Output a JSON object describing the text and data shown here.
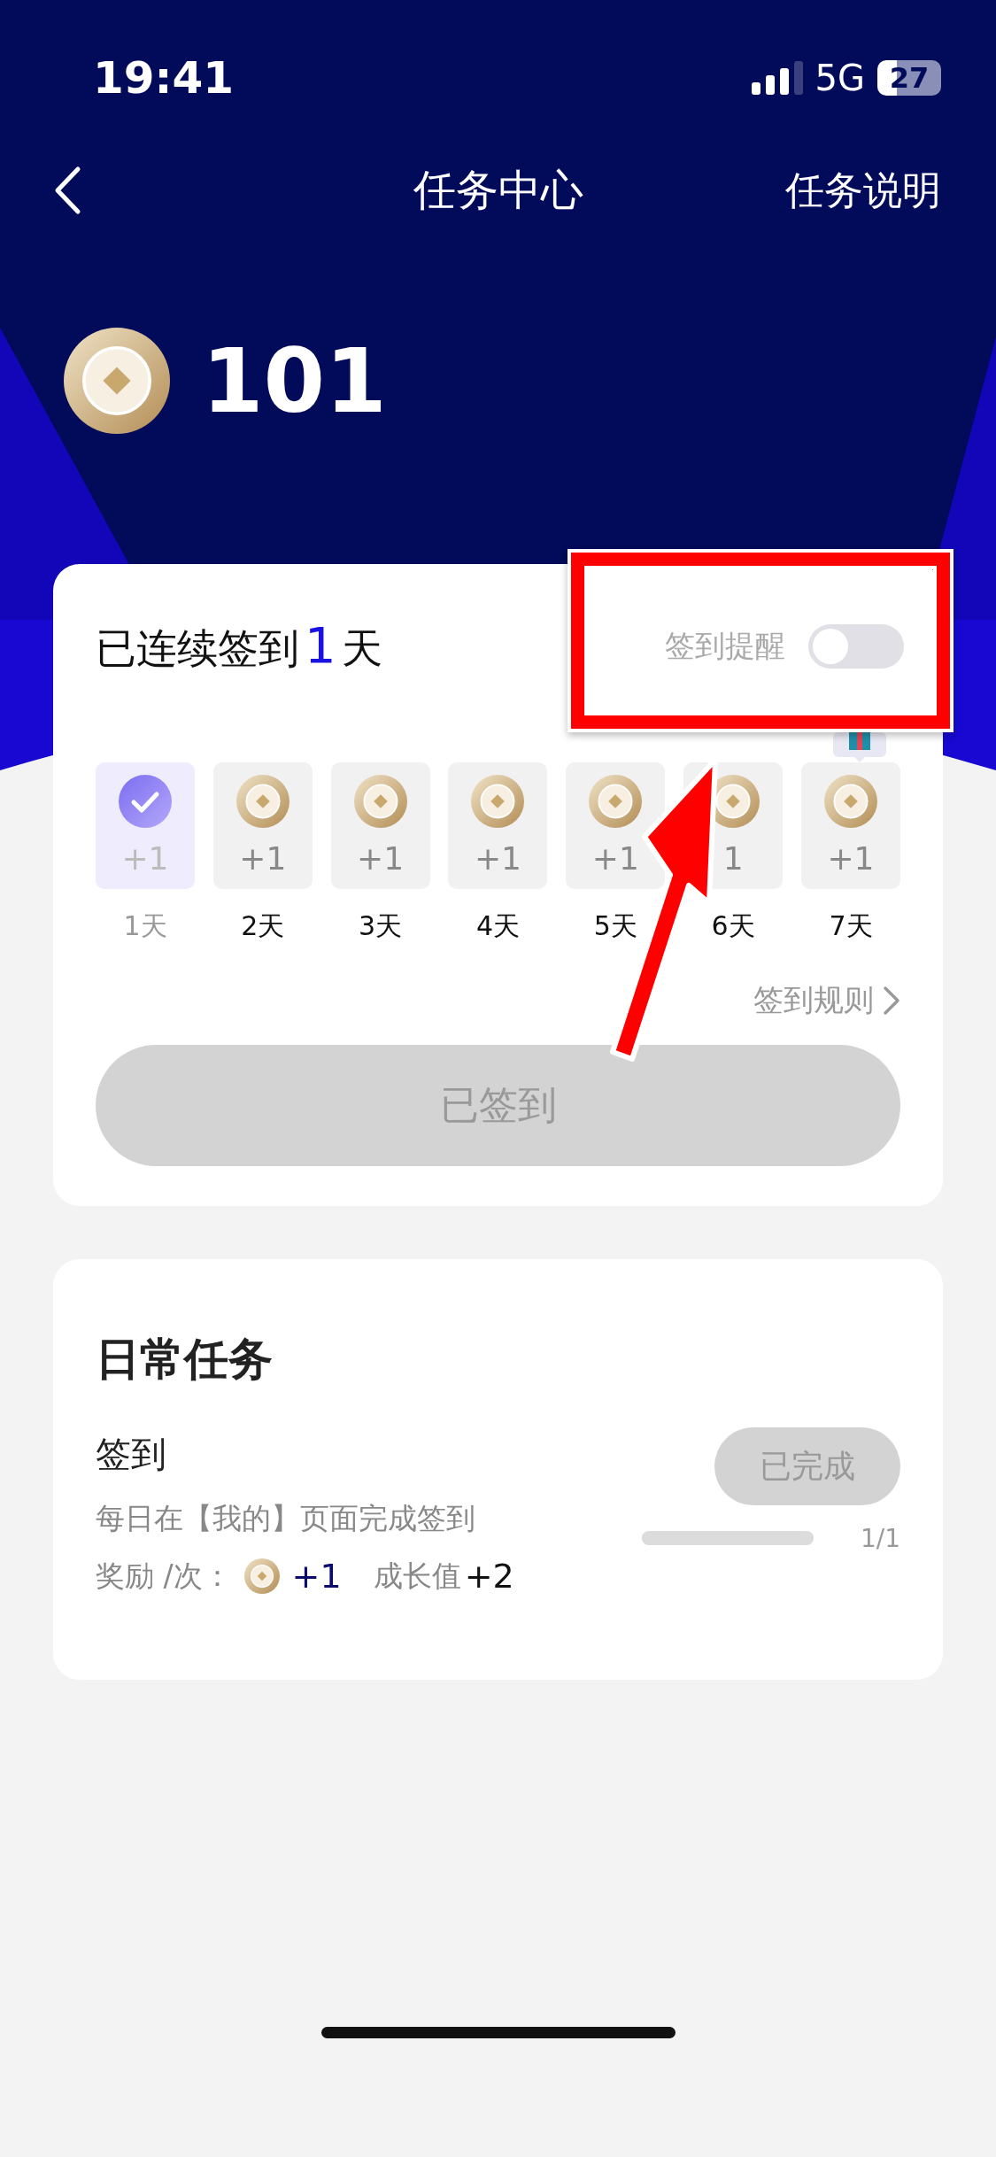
{
  "status_bar": {
    "time": "19:41",
    "network": "5G",
    "battery": "27"
  },
  "nav": {
    "title": "任务中心",
    "action": "任务说明"
  },
  "points": {
    "balance": "101"
  },
  "checkin": {
    "prefix": "已连续签到",
    "count": "1",
    "suffix": "天",
    "reminder": {
      "label": "签到提醒",
      "on": false
    },
    "days": [
      {
        "reward": "+1",
        "label": "1天",
        "checked": true
      },
      {
        "reward": "+1",
        "label": "2天",
        "checked": false
      },
      {
        "reward": "+1",
        "label": "3天",
        "checked": false
      },
      {
        "reward": "+1",
        "label": "4天",
        "checked": false
      },
      {
        "reward": "+1",
        "label": "5天",
        "checked": false
      },
      {
        "reward": "1",
        "label": "6天",
        "checked": false
      },
      {
        "reward": "+1",
        "label": "7天",
        "checked": false
      }
    ],
    "rules_link": "签到规则",
    "button": {
      "label": "已签到",
      "disabled": true
    }
  },
  "daily_tasks": {
    "title": "日常任务",
    "tasks": [
      {
        "name": "签到",
        "description": "每日在【我的】页面完成签到",
        "reward_label": "奖励 /次：",
        "coin_reward": "+1",
        "growth_label": "成长值",
        "growth_reward": "+2",
        "button": {
          "label": "已完成",
          "disabled": true
        },
        "level": 1,
        "progress": "1/1"
      }
    ]
  }
}
